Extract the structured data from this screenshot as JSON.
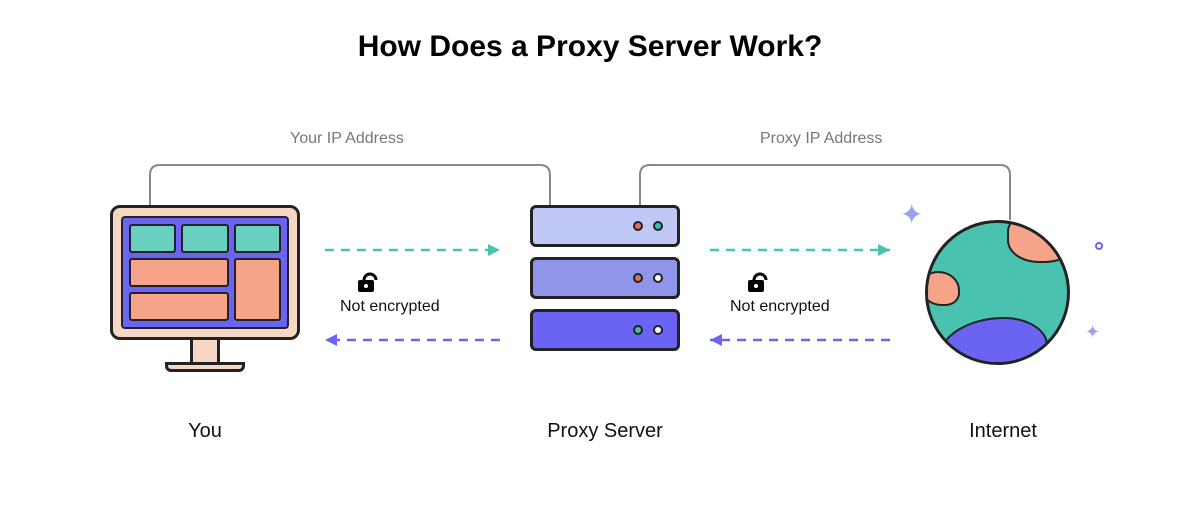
{
  "title": "How Does a Proxy Server Work?",
  "brackets": {
    "left": "Your IP Address",
    "right": "Proxy IP Address"
  },
  "nodes": {
    "you": "You",
    "proxy": "Proxy Server",
    "internet": "Internet"
  },
  "connections": {
    "left": {
      "status": "Not encrypted"
    },
    "right": {
      "status": "Not encrypted"
    }
  },
  "colors": {
    "teal": "#49c2b0",
    "violet": "#6b63f2",
    "peach": "#f6d7c6",
    "coral": "#f5a48a",
    "gray": "#888888"
  }
}
